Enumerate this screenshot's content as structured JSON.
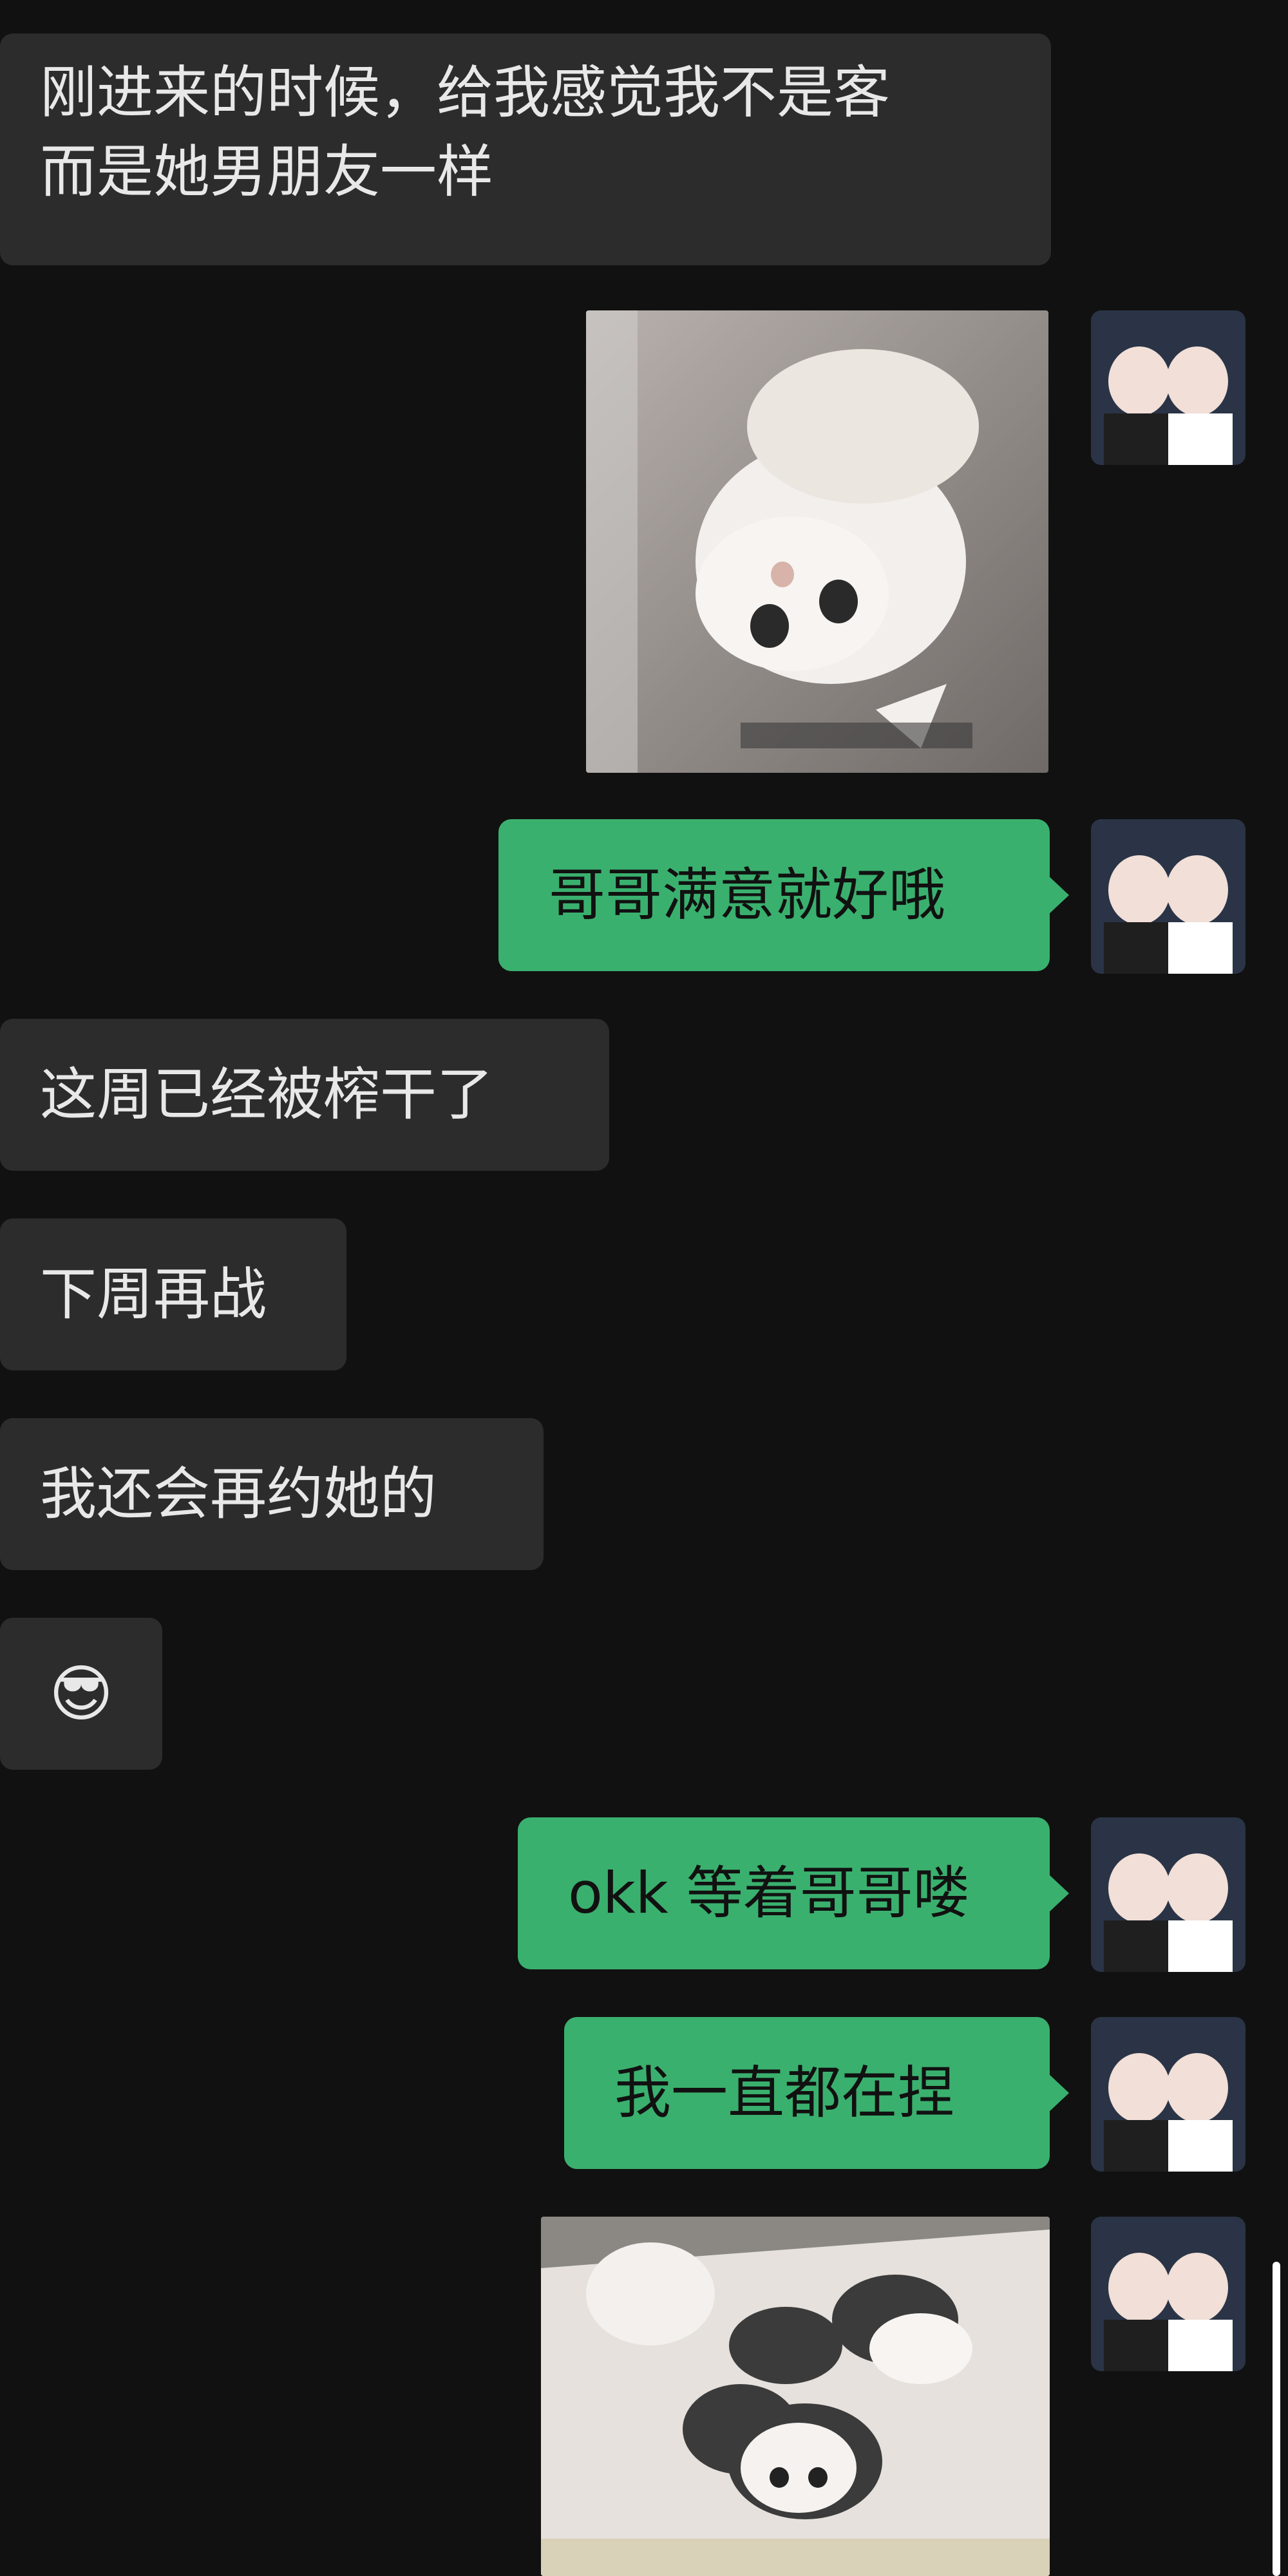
{
  "chat": {
    "messages": [
      {
        "side": "left",
        "type": "text",
        "line1": "刚进来的时候，给我感觉我不是客",
        "line2": "而是她男朋友一样"
      },
      {
        "side": "right",
        "type": "image",
        "label": "cat-in-box sticker"
      },
      {
        "side": "right",
        "type": "text",
        "text": "哥哥满意就好哦"
      },
      {
        "side": "left",
        "type": "text",
        "text": "这周已经被榨干了"
      },
      {
        "side": "left",
        "type": "text",
        "text": "下周再战"
      },
      {
        "side": "left",
        "type": "text",
        "text": "我还会再约她的"
      },
      {
        "side": "left",
        "type": "emoji",
        "text": "😎"
      },
      {
        "side": "right",
        "type": "text",
        "text": "okk 等着哥哥喽"
      },
      {
        "side": "right",
        "type": "text",
        "text": "我一直都在捏"
      },
      {
        "side": "right",
        "type": "image",
        "label": "cats-in-holes sticker"
      }
    ]
  },
  "colors": {
    "background": "#111111",
    "left_bubble": "#2c2c2c",
    "right_bubble": "#3ab06e",
    "text_light": "#e8e8e8"
  }
}
